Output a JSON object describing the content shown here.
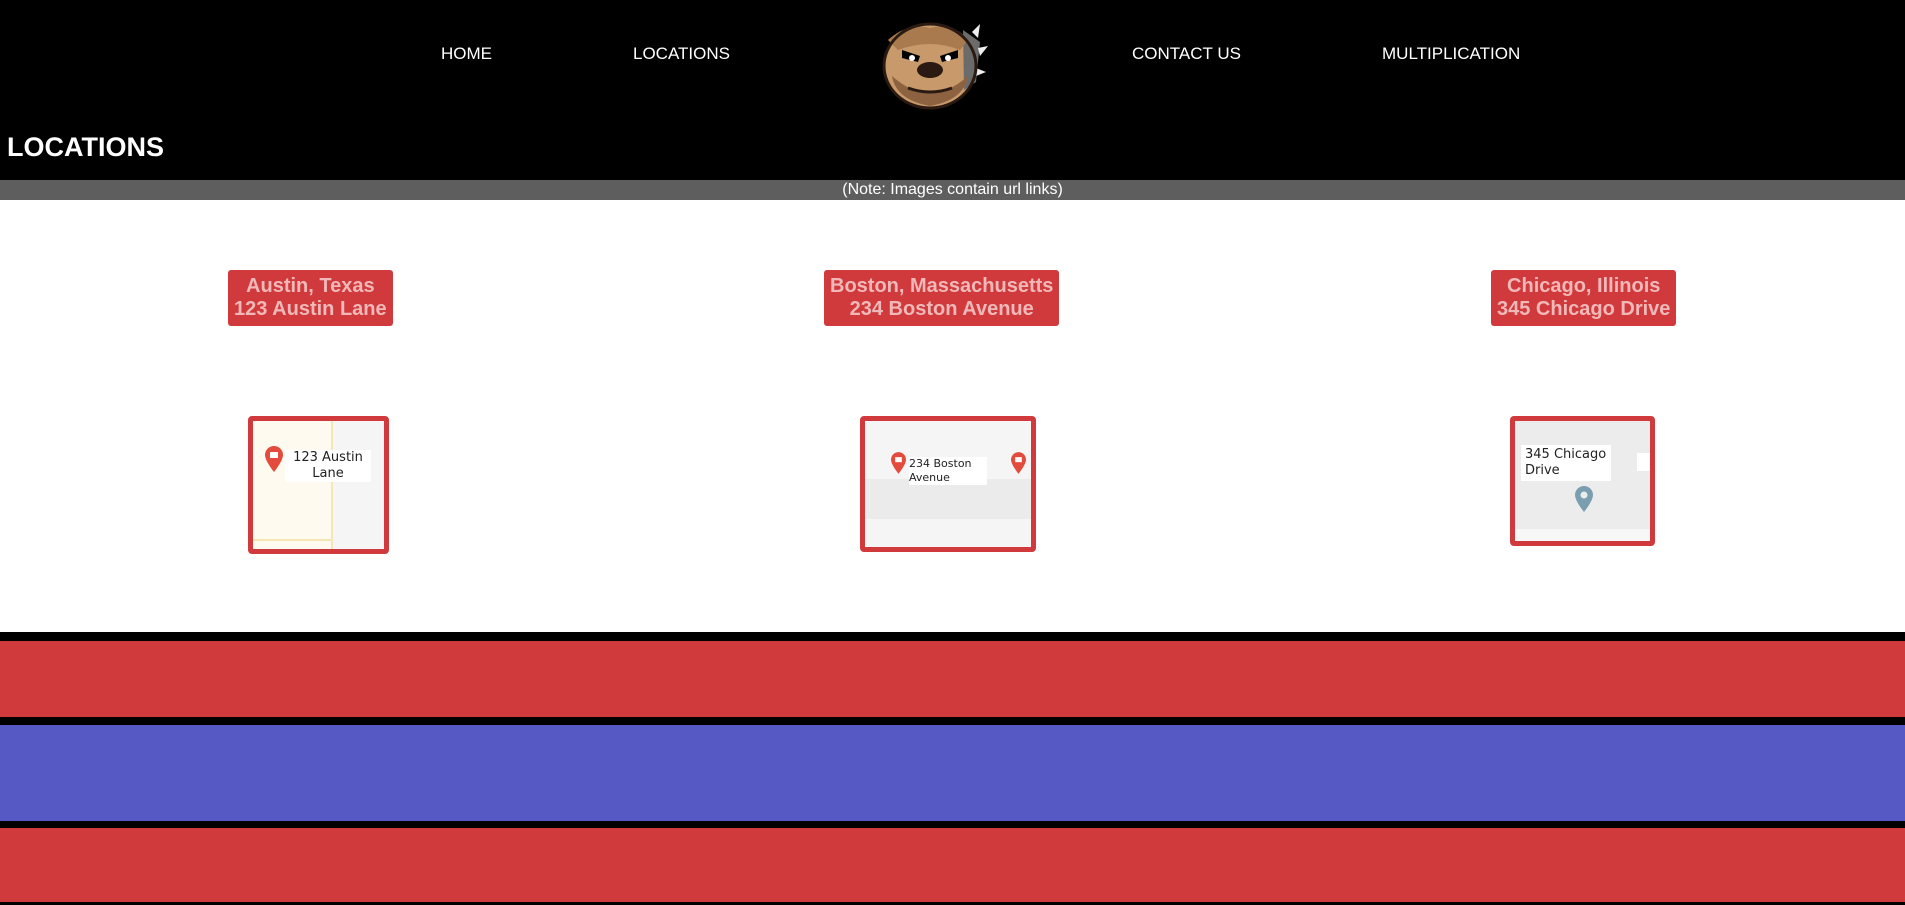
{
  "nav": {
    "home": "HOME",
    "locations": "LOCATIONS",
    "contact": "CONTACT US",
    "multiplication": "MULTIPLICATION",
    "logo_icon": "bulldog-logo-icon"
  },
  "page": {
    "title": "LOCATIONS",
    "note": "(Note: Images contain url links)"
  },
  "locations": [
    {
      "city": "Austin, Texas",
      "address": "123 Austin Lane",
      "map_label": "123 Austin Lane"
    },
    {
      "city": "Boston, Massachusetts",
      "address": "234 Boston Avenue",
      "map_label": "234 Boston Avenue"
    },
    {
      "city": "Chicago, Illinois",
      "address": "345 Chicago Drive",
      "map_label": "345 Chicago Drive"
    }
  ],
  "colors": {
    "accent_red": "#d13a3c",
    "accent_blue": "#5659c4",
    "nav_bg": "#000000",
    "note_bar": "#5e5e5e"
  }
}
